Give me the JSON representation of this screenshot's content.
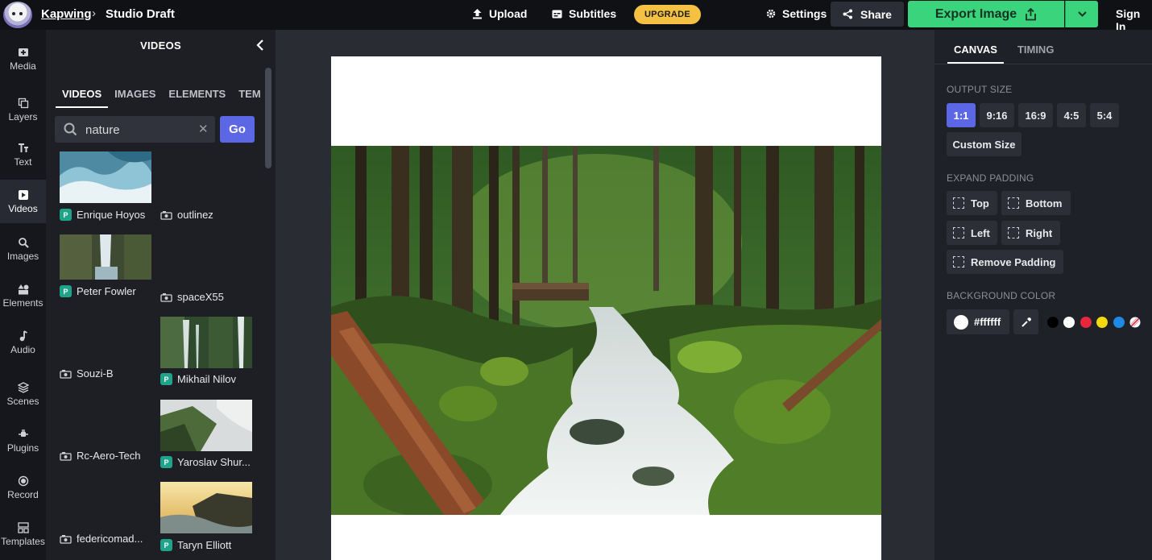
{
  "topbar": {
    "brand": "Kapwing",
    "separator": "›",
    "project_title": "Studio Draft",
    "upload_label": "Upload",
    "subtitles_label": "Subtitles",
    "upgrade_label": "UPGRADE",
    "settings_label": "Settings",
    "share_label": "Share",
    "export_label": "Export Image",
    "signin_label": "Sign In"
  },
  "rail": [
    {
      "label": "Media",
      "icon": "media-icon"
    },
    {
      "label": "Layers",
      "icon": "layers-icon"
    },
    {
      "label": "Text",
      "icon": "text-icon"
    },
    {
      "label": "Videos",
      "icon": "videos-icon"
    },
    {
      "label": "Images",
      "icon": "images-icon"
    },
    {
      "label": "Elements",
      "icon": "elements-icon"
    },
    {
      "label": "Audio",
      "icon": "audio-icon"
    },
    {
      "label": "Scenes",
      "icon": "scenes-icon"
    },
    {
      "label": "Plugins",
      "icon": "plugins-icon"
    },
    {
      "label": "Record",
      "icon": "record-icon"
    },
    {
      "label": "Templates",
      "icon": "templates-icon"
    }
  ],
  "panel": {
    "title": "VIDEOS",
    "tabs": [
      "VIDEOS",
      "IMAGES",
      "ELEMENTS",
      "TEM"
    ],
    "search": {
      "value": "nature",
      "clear": "✕",
      "go_label": "Go"
    },
    "results": [
      {
        "author": "Enrique Hoyos",
        "source": "pexels"
      },
      {
        "author": "outlinez",
        "source": "giphy"
      },
      {
        "author": "Peter Fowler",
        "source": "pexels"
      },
      {
        "author": "spaceX55",
        "source": "giphy"
      },
      {
        "author": "Souzi-B",
        "source": "giphy"
      },
      {
        "author": "Mikhail Nilov",
        "source": "pexels"
      },
      {
        "author": "Rc-Aero-Tech",
        "source": "giphy"
      },
      {
        "author": "Yaroslav Shur...",
        "source": "pexels"
      },
      {
        "author": "federicomad...",
        "source": "giphy"
      },
      {
        "author": "Taryn Elliott",
        "source": "pexels"
      }
    ]
  },
  "props": {
    "tabs": [
      "CANVAS",
      "TIMING"
    ],
    "output_size_label": "OUTPUT SIZE",
    "sizes": [
      "1:1",
      "9:16",
      "16:9",
      "4:5",
      "5:4"
    ],
    "selected_size": "1:1",
    "custom_size_label": "Custom Size",
    "expand_padding_label": "EXPAND PADDING",
    "padding": {
      "top": "Top",
      "bottom": "Bottom",
      "left": "Left",
      "right": "Right",
      "remove": "Remove Padding"
    },
    "background_color_label": "BACKGROUND COLOR",
    "background_color": "#ffffff",
    "swatches": [
      "#000000",
      "#ffffff",
      "#e8263c",
      "#f5d90a",
      "#1e88e5",
      "none"
    ]
  },
  "colors": {
    "accent": "#5b67e5",
    "export_green": "#39d47b",
    "upgrade_yellow": "#f4c143"
  }
}
